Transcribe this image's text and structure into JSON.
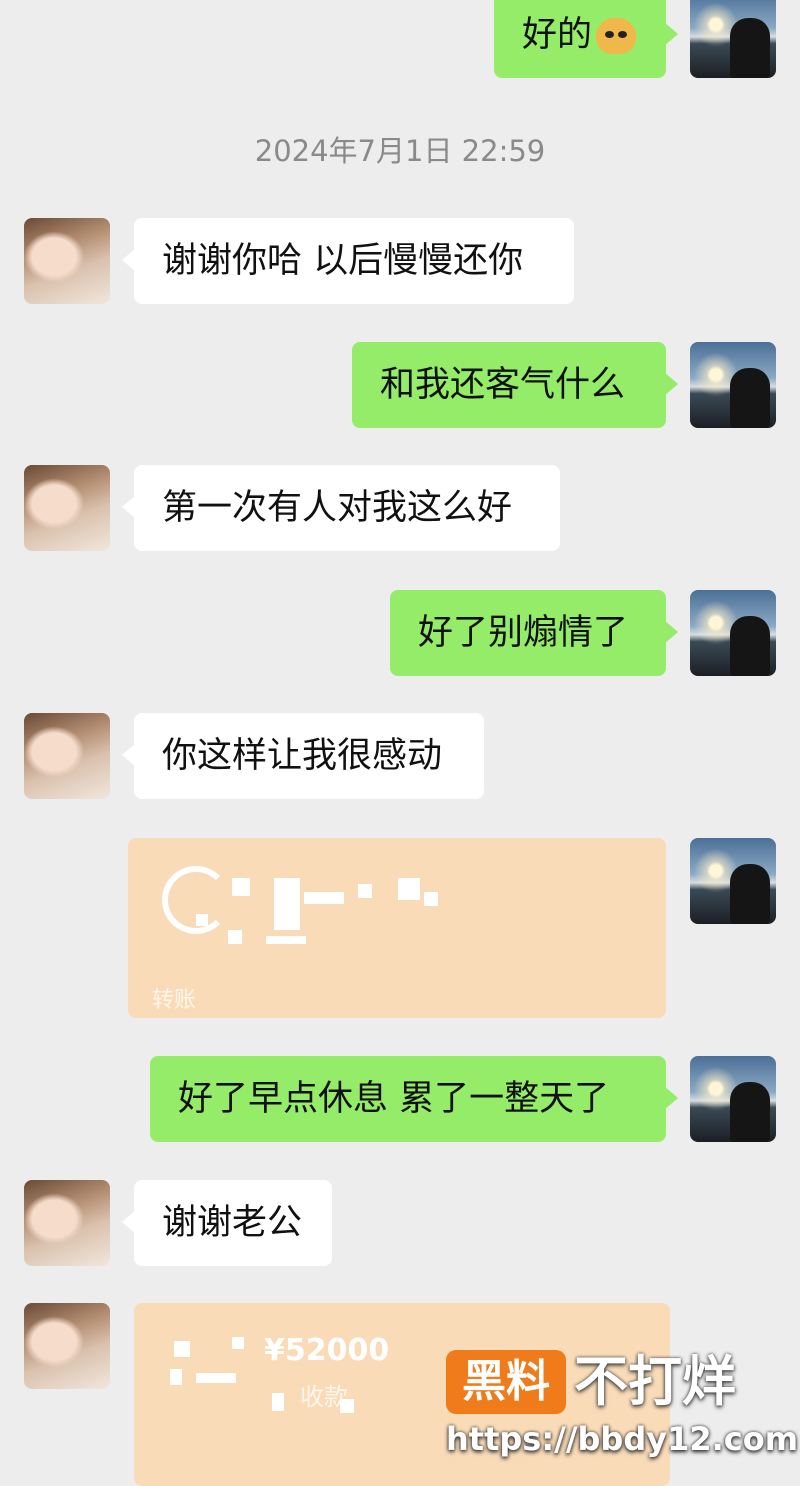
{
  "timestamp": "2024年7月1日  22:59",
  "messages": [
    {
      "side": "self",
      "text": "好的"
    },
    {
      "side": "other",
      "text": "谢谢你哈 以后慢慢还你"
    },
    {
      "side": "self",
      "text": "和我还客气什么"
    },
    {
      "side": "other",
      "text": "第一次有人对我这么好"
    },
    {
      "side": "self",
      "text": "好了别煽情了"
    },
    {
      "side": "other",
      "text": "你这样让我很感动"
    },
    {
      "side": "self",
      "type": "transfer",
      "label": "转账"
    },
    {
      "side": "self",
      "text": "好了早点休息 累了一整天了"
    },
    {
      "side": "other",
      "text": "谢谢老公"
    },
    {
      "side": "other",
      "type": "transfer",
      "amount": "¥52000",
      "label": "收款"
    }
  ],
  "emoji": "doge-emoji",
  "watermark": {
    "badge": "黑料",
    "title": "不打烊",
    "url": "https://bbdy12.com"
  },
  "colors": {
    "self_bubble": "#95ec69",
    "other_bubble": "#ffffff",
    "transfer": "#f9dbb7",
    "background": "#ededed",
    "watermark_badge": "#f07b1b"
  }
}
